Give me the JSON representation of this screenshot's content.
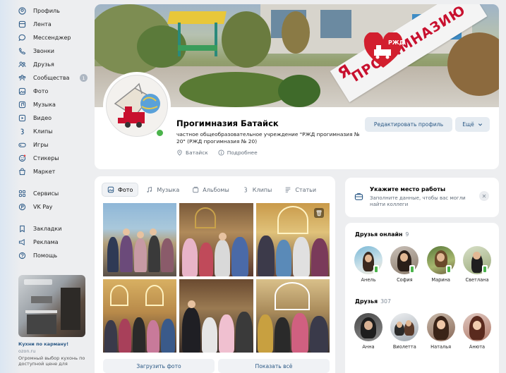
{
  "sidebar": {
    "items": [
      {
        "label": "Профиль",
        "icon": "user-circle-icon"
      },
      {
        "label": "Лента",
        "icon": "feed-icon"
      },
      {
        "label": "Мессенджер",
        "icon": "message-icon"
      },
      {
        "label": "Звонки",
        "icon": "phone-icon"
      },
      {
        "label": "Друзья",
        "icon": "friends-icon"
      },
      {
        "label": "Сообщества",
        "icon": "communities-icon",
        "badge": "1"
      },
      {
        "label": "Фото",
        "icon": "photo-icon"
      },
      {
        "label": "Музыка",
        "icon": "music-icon"
      },
      {
        "label": "Видео",
        "icon": "video-icon"
      },
      {
        "label": "Клипы",
        "icon": "clips-icon"
      },
      {
        "label": "Игры",
        "icon": "games-icon"
      },
      {
        "label": "Стикеры",
        "icon": "stickers-icon"
      },
      {
        "label": "Маркет",
        "icon": "market-icon"
      }
    ],
    "items2": [
      {
        "label": "Сервисы",
        "icon": "services-icon"
      },
      {
        "label": "VK Pay",
        "icon": "vkpay-icon"
      }
    ],
    "items3": [
      {
        "label": "Закладки",
        "icon": "bookmark-icon"
      },
      {
        "label": "Реклама",
        "icon": "ads-icon"
      },
      {
        "label": "Помощь",
        "icon": "help-icon"
      }
    ],
    "ad": {
      "title": "Кухни по карману!",
      "url": "ozon.ru",
      "text": "Огромный выбор кухонь по доступной цене для"
    }
  },
  "profile": {
    "banner_text": "ПРОГИМНАЗИЮ",
    "banner_prefix": "Я",
    "logo_text": "РЖД",
    "name": "Прогимназия Батайск",
    "description": "частное общеобразовательное учреждение \"РЖД прогимназия № 20\" (РЖД прогимназия № 20)",
    "city": "Батайск",
    "more_info": "Подробнее",
    "edit_button": "Редактировать профиль",
    "more_button": "Ещё"
  },
  "photos": {
    "tabs": [
      {
        "label": "Фото",
        "icon": "photo-icon",
        "active": true
      },
      {
        "label": "Музыка",
        "icon": "music-icon",
        "active": false
      },
      {
        "label": "Альбомы",
        "icon": "albums-icon",
        "active": false
      },
      {
        "label": "Клипы",
        "icon": "clips-icon",
        "active": false
      },
      {
        "label": "Статьи",
        "icon": "articles-icon",
        "active": false
      }
    ],
    "upload_button": "Загрузить фото",
    "show_all_button": "Показать всё"
  },
  "work": {
    "title": "Укажите место работы",
    "subtitle": "Заполните данные, чтобы вас могли найти коллеги"
  },
  "friends_online": {
    "title": "Друзья онлайн",
    "count": "9",
    "people": [
      "Анель",
      "София",
      "Марина",
      "Светлана"
    ]
  },
  "friends": {
    "title": "Друзья",
    "count": "307",
    "people": [
      "Анна",
      "Виолетта",
      "Наталья",
      "Анюта"
    ]
  },
  "colors": {
    "accent": "#2a5885",
    "online": "#4bb34b",
    "brand_red": "#c8102e",
    "page_bg": "#edeef0"
  }
}
